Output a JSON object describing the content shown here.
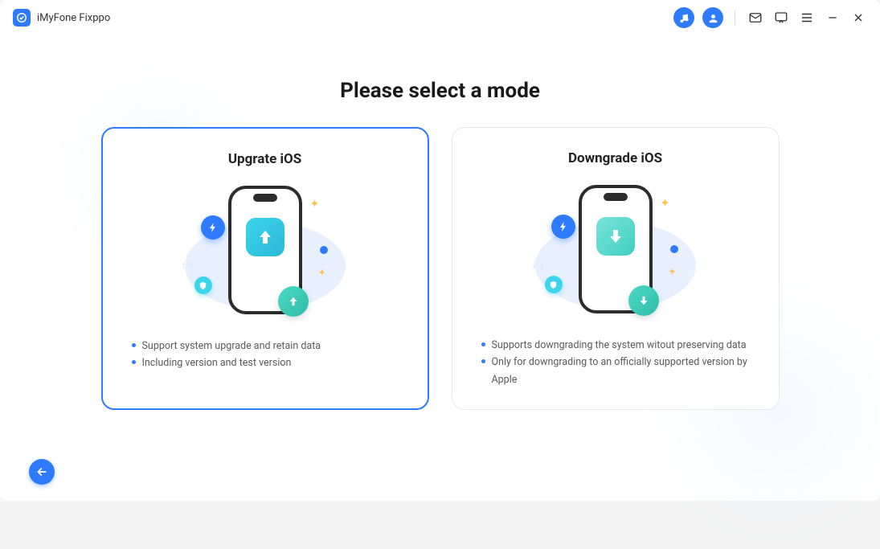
{
  "app": {
    "title": "iMyFone Fixppo"
  },
  "page": {
    "title": "Please select a mode"
  },
  "cards": {
    "upgrade": {
      "title": "Upgrate iOS",
      "bullets": [
        "Support system upgrade and retain data",
        "Including version and test version"
      ],
      "selected": true
    },
    "downgrade": {
      "title": "Downgrade iOS",
      "bullets": [
        "Supports downgrading the system witout preserving data",
        "Only for downgrading to an officially supported version by Apple"
      ],
      "selected": false
    }
  },
  "colors": {
    "accent": "#2e7bff",
    "teal": "#3dd5ea"
  }
}
